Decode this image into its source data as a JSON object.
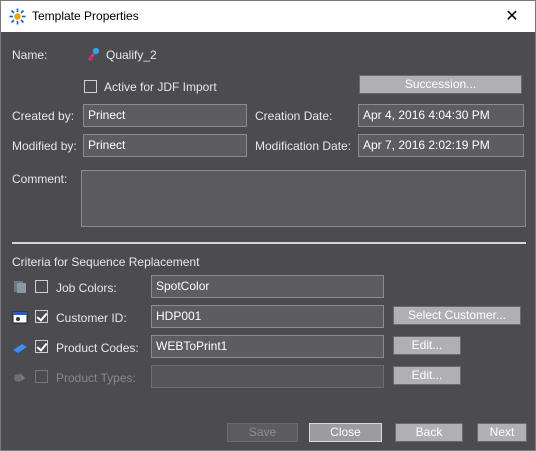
{
  "window": {
    "title": "Template Properties",
    "close_glyph": "✕"
  },
  "name": {
    "label": "Name:",
    "value": "Qualify_2",
    "icon": "template-person-icon"
  },
  "active_jdf": {
    "label": "Active for JDF Import",
    "checked": false
  },
  "succession_button": "Succession...",
  "created_by": {
    "label": "Created by:",
    "value": "Prinect"
  },
  "creation_date": {
    "label": "Creation Date:",
    "value": "Apr 4, 2016 4:04:30 PM"
  },
  "modified_by": {
    "label": "Modified by:",
    "value": "Prinect"
  },
  "modification_date": {
    "label": "Modification Date:",
    "value": "Apr 7, 2016 2:02:19 PM"
  },
  "comment": {
    "label": "Comment:",
    "value": ""
  },
  "criteria": {
    "heading": "Criteria for Sequence Replacement",
    "rows": [
      {
        "label": "Job Colors:",
        "value": "SpotColor",
        "checked": false,
        "enabled": true,
        "icon": "job-colors-icon",
        "button": ""
      },
      {
        "label": "Customer ID:",
        "value": "HDP001",
        "checked": true,
        "enabled": true,
        "icon": "customer-card-icon",
        "button": "Select Customer..."
      },
      {
        "label": "Product Codes:",
        "value": "WEBToPrint1",
        "checked": true,
        "enabled": true,
        "icon": "product-codes-icon",
        "button": "Edit..."
      },
      {
        "label": "Product Types:",
        "value": "",
        "checked": false,
        "enabled": false,
        "icon": "product-types-icon",
        "button": "Edit..."
      }
    ]
  },
  "footer": {
    "save": "Save",
    "close": "Close",
    "back": "Back",
    "next": "Next"
  }
}
